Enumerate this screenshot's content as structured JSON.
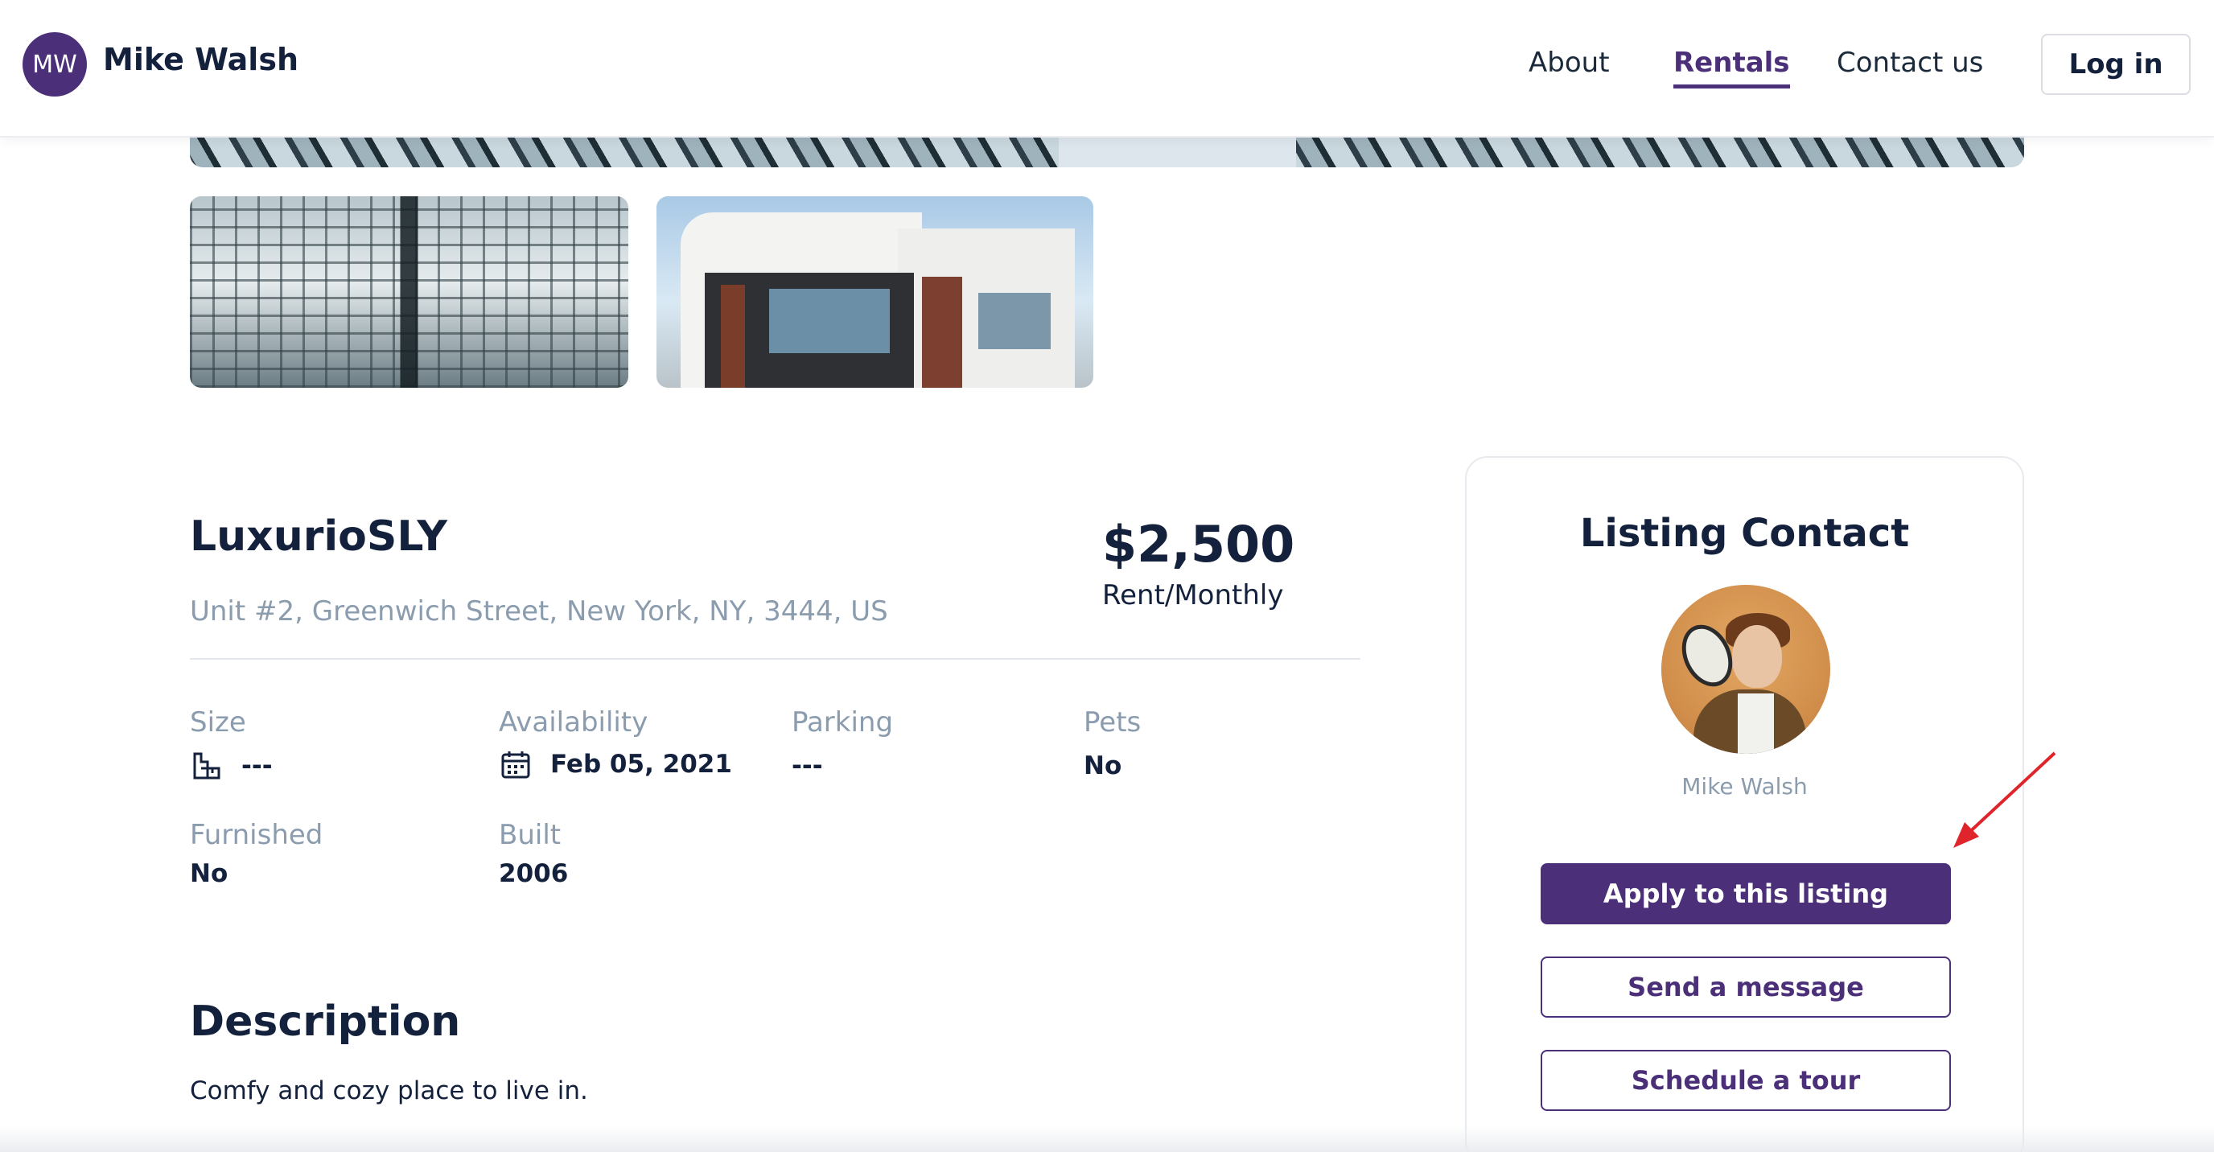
{
  "header": {
    "avatar_initials": "MW",
    "brand_name": "Mike Walsh",
    "nav": [
      {
        "label": "About",
        "active": false
      },
      {
        "label": "Rentals",
        "active": true
      },
      {
        "label": "Contact us",
        "active": false
      }
    ],
    "login_label": "Log in"
  },
  "listing": {
    "title": "LuxurioSLY",
    "address": "Unit #2, Greenwich Street, New York, NY, 3444, US",
    "price": "$2,500",
    "price_period": "Rent/Monthly",
    "details": {
      "size": {
        "label": "Size",
        "value": "---",
        "icon": "floorplan-icon"
      },
      "availability": {
        "label": "Availability",
        "value": "Feb 05, 2021",
        "icon": "calendar-icon"
      },
      "parking": {
        "label": "Parking",
        "value": "---"
      },
      "pets": {
        "label": "Pets",
        "value": "No"
      },
      "furnished": {
        "label": "Furnished",
        "value": "No"
      },
      "built": {
        "label": "Built",
        "value": "2006"
      }
    },
    "description_title": "Description",
    "description_text": "Comfy and cozy place to live in."
  },
  "contact": {
    "title": "Listing Contact",
    "name": "Mike Walsh",
    "buttons": {
      "apply": "Apply to this listing",
      "message": "Send a message",
      "tour": "Schedule a tour"
    }
  },
  "colors": {
    "accent": "#4b3079",
    "text_dark": "#14213d",
    "text_muted": "#8a9cae",
    "annotation_arrow": "#e0242b"
  }
}
